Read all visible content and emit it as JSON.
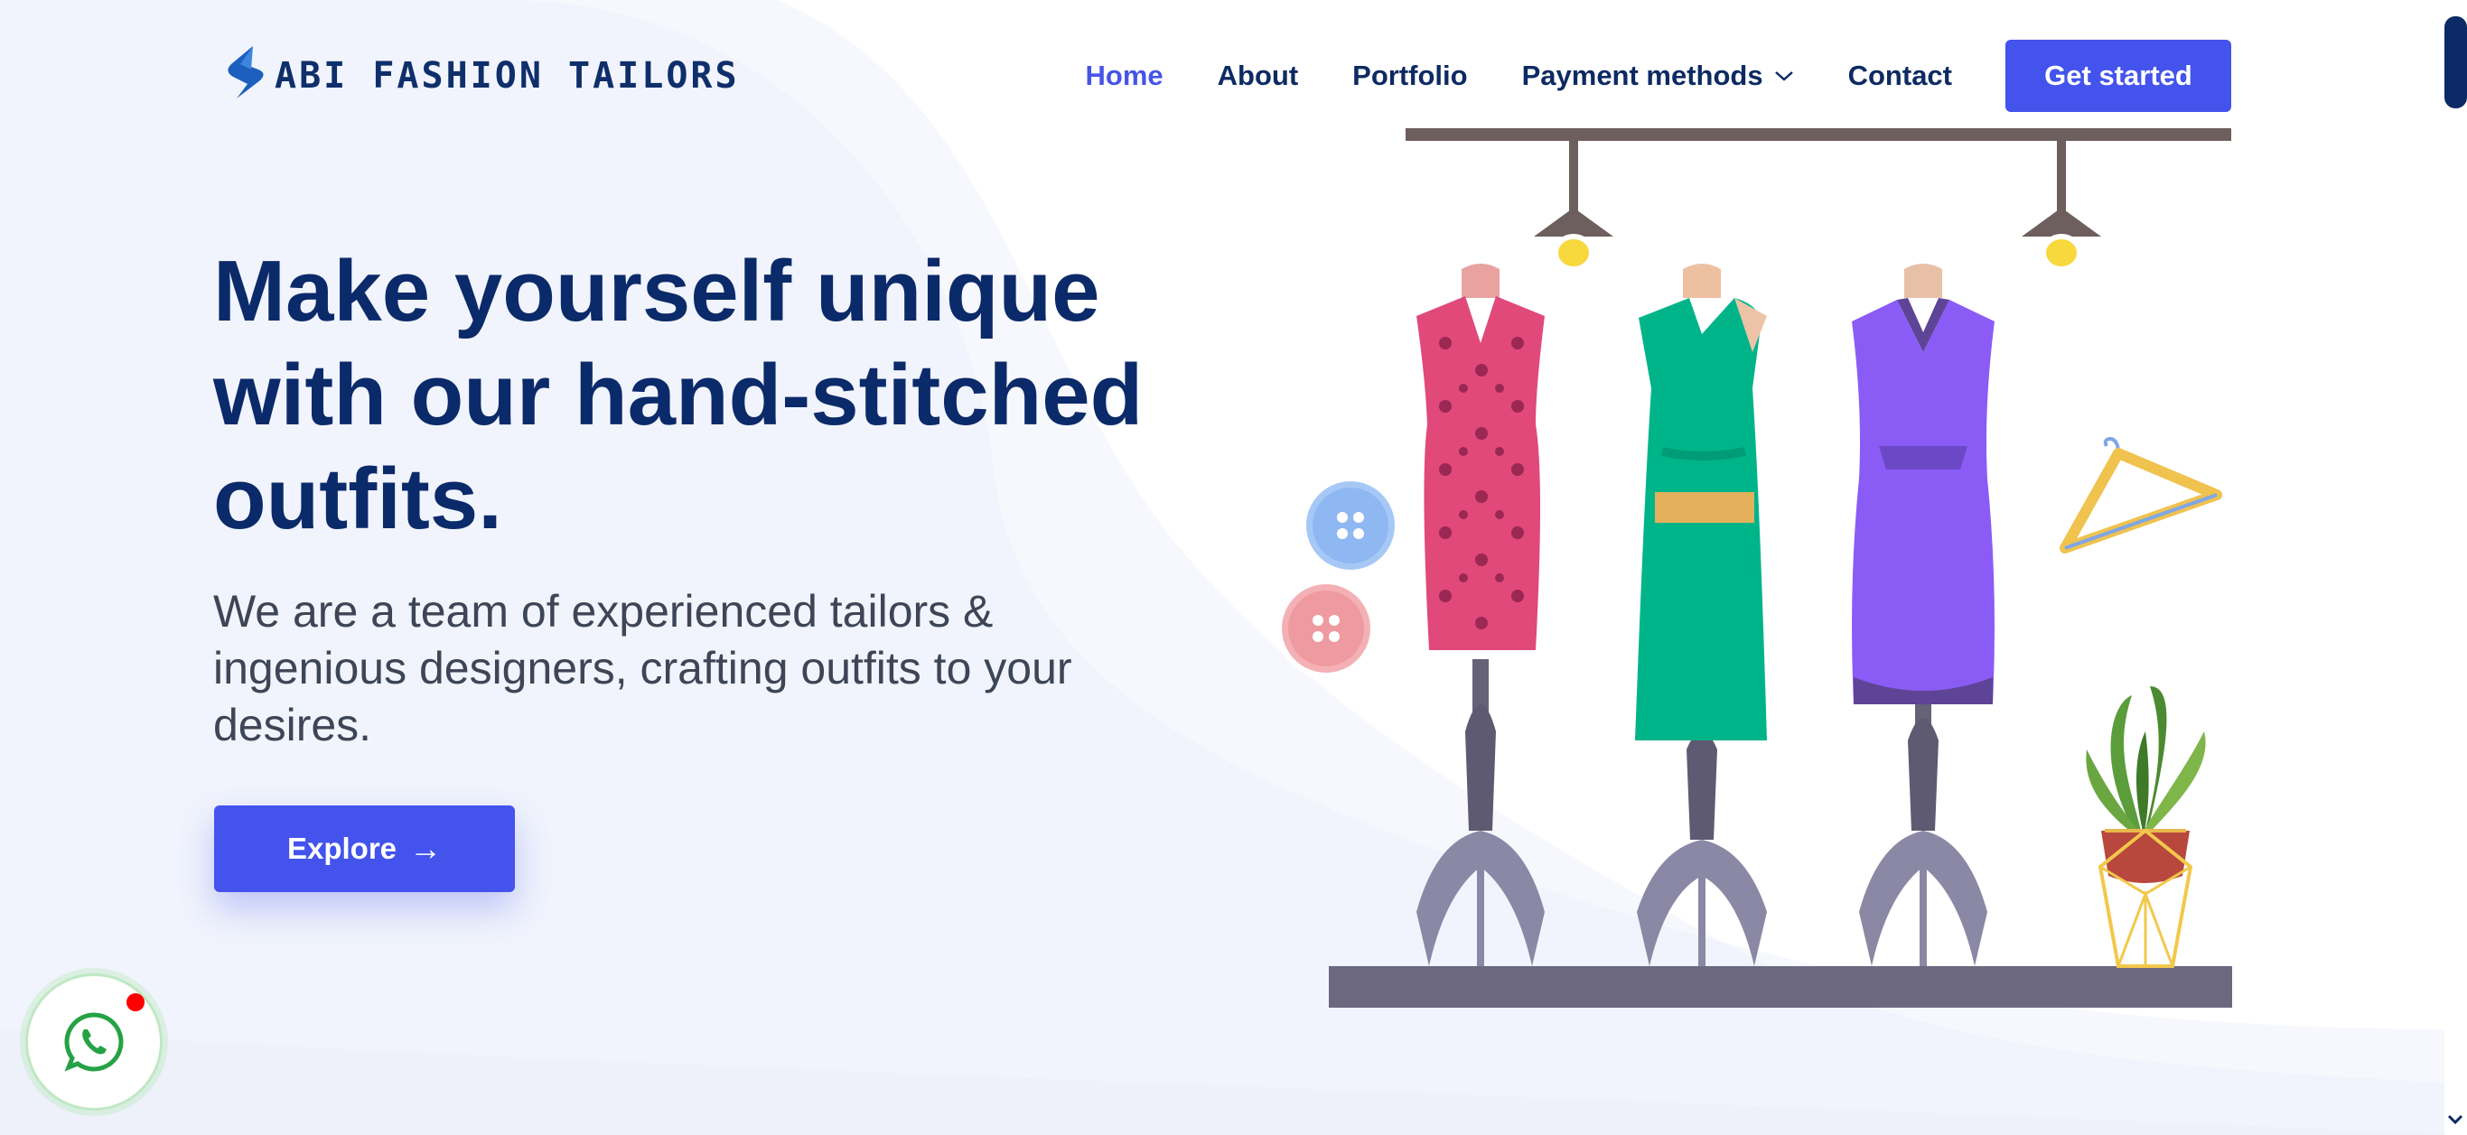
{
  "brand": {
    "name": "ABI FASHION TAILORS",
    "logo_icon": "s-logo-icon"
  },
  "nav": {
    "items": [
      {
        "label": "Home",
        "active": true
      },
      {
        "label": "About"
      },
      {
        "label": "Portfolio"
      },
      {
        "label": "Payment methods",
        "has_dropdown": true
      },
      {
        "label": "Contact"
      }
    ],
    "cta_label": "Get started"
  },
  "hero": {
    "title": "Make yourself unique with our hand-stitched outfits.",
    "subtitle": "We are a team of experienced tailors & ingenious designers, crafting outfits to your desires.",
    "button_label": "Explore",
    "button_icon": "arrow-right-icon"
  },
  "floating": {
    "whatsapp_icon": "whatsapp-icon",
    "notification": true
  },
  "colors": {
    "primary": "#4353ec",
    "navy": "#0b2a6a",
    "background": "#f1f4fc",
    "pink_dress": "#e0497a",
    "green_dress": "#00b48a",
    "purple_dress": "#8a5cf5",
    "stand": "#6b6880"
  }
}
